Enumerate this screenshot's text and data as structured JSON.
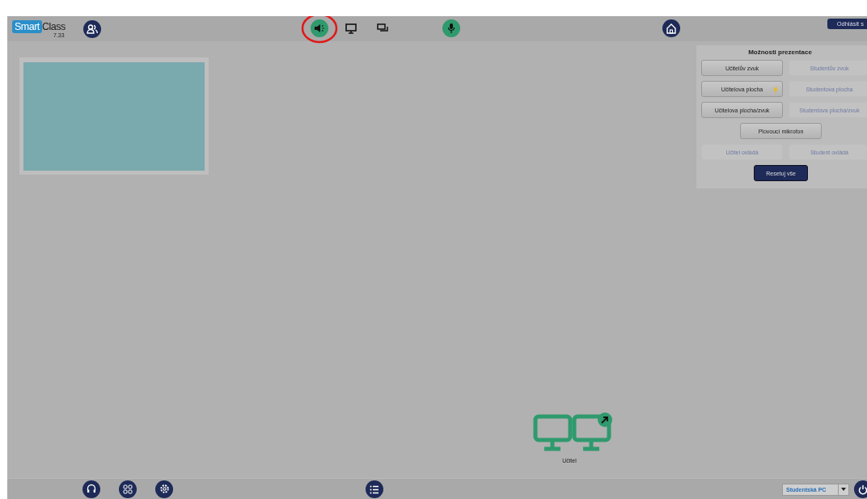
{
  "logo": {
    "brand_a": "Smart",
    "brand_b": "Class",
    "version": "7.33"
  },
  "toolbar": [
    {
      "kind": "speaker",
      "active": true,
      "highlighted": true
    },
    {
      "kind": "monitor",
      "active": false,
      "highlighted": false
    },
    {
      "kind": "chat",
      "active": false,
      "highlighted": false
    },
    {
      "kind": "mic",
      "active": true,
      "highlighted": false
    }
  ],
  "logout": {
    "label": "Odhlásit s"
  },
  "options": {
    "title": "Možnosti prezentace",
    "rows": [
      [
        {
          "label": "Učitelův zvuk",
          "disabled": false,
          "badge": false,
          "kind": "normal"
        },
        {
          "label": "Studentův zvuk",
          "disabled": true,
          "badge": false,
          "kind": "normal"
        }
      ],
      [
        {
          "label": "Učitelova plocha",
          "disabled": false,
          "badge": true,
          "kind": "normal"
        },
        {
          "label": "Studentova plocha",
          "disabled": true,
          "badge": false,
          "kind": "normal"
        }
      ],
      [
        {
          "label": "Učitelova plocha/zvuk",
          "disabled": false,
          "badge": false,
          "kind": "normal"
        },
        {
          "label": "Studentova plocha/zvuk",
          "disabled": true,
          "badge": false,
          "kind": "normal"
        }
      ],
      [
        {
          "label": "Plovoucí mikrofon",
          "disabled": false,
          "badge": false,
          "kind": "normal"
        }
      ],
      [
        {
          "label": "Učitel ovládá",
          "disabled": true,
          "badge": false,
          "kind": "normal"
        },
        {
          "label": "Student ovládá",
          "disabled": true,
          "badge": false,
          "kind": "normal"
        }
      ],
      [
        {
          "label": "Resetuj vše",
          "disabled": false,
          "badge": false,
          "kind": "primary"
        }
      ]
    ]
  },
  "teacher": {
    "label": "Učitel"
  },
  "bottom": {
    "icons": [
      {
        "kind": "headset"
      },
      {
        "kind": "grid"
      },
      {
        "kind": "gear"
      },
      {
        "kind": "list"
      }
    ],
    "select": {
      "value": "Studentská PC"
    }
  }
}
